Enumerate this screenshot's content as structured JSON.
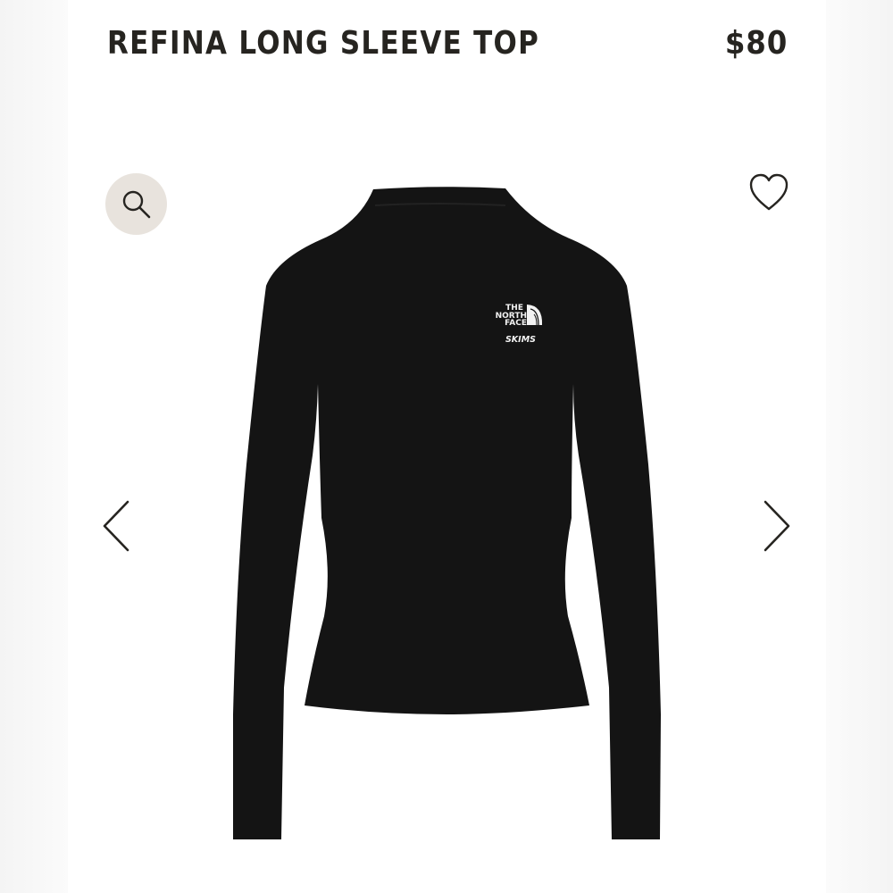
{
  "product": {
    "title": "REFINA LONG SLEEVE TOP",
    "price": "$80"
  },
  "image": {
    "subject": "black long sleeve top, back view",
    "garment_color": "#141414",
    "brand_mark": {
      "line1": "THE",
      "line2": "NORTH",
      "line3": "FACE",
      "collab": "SKIMS"
    }
  },
  "controls": {
    "zoom_icon": "search-icon",
    "favorite_icon": "heart-icon",
    "prev_icon": "chevron-left-icon",
    "next_icon": "chevron-right-icon"
  },
  "colors": {
    "text": "#262420",
    "zoom_bg": "#e8e3dd",
    "background": "#ffffff"
  }
}
